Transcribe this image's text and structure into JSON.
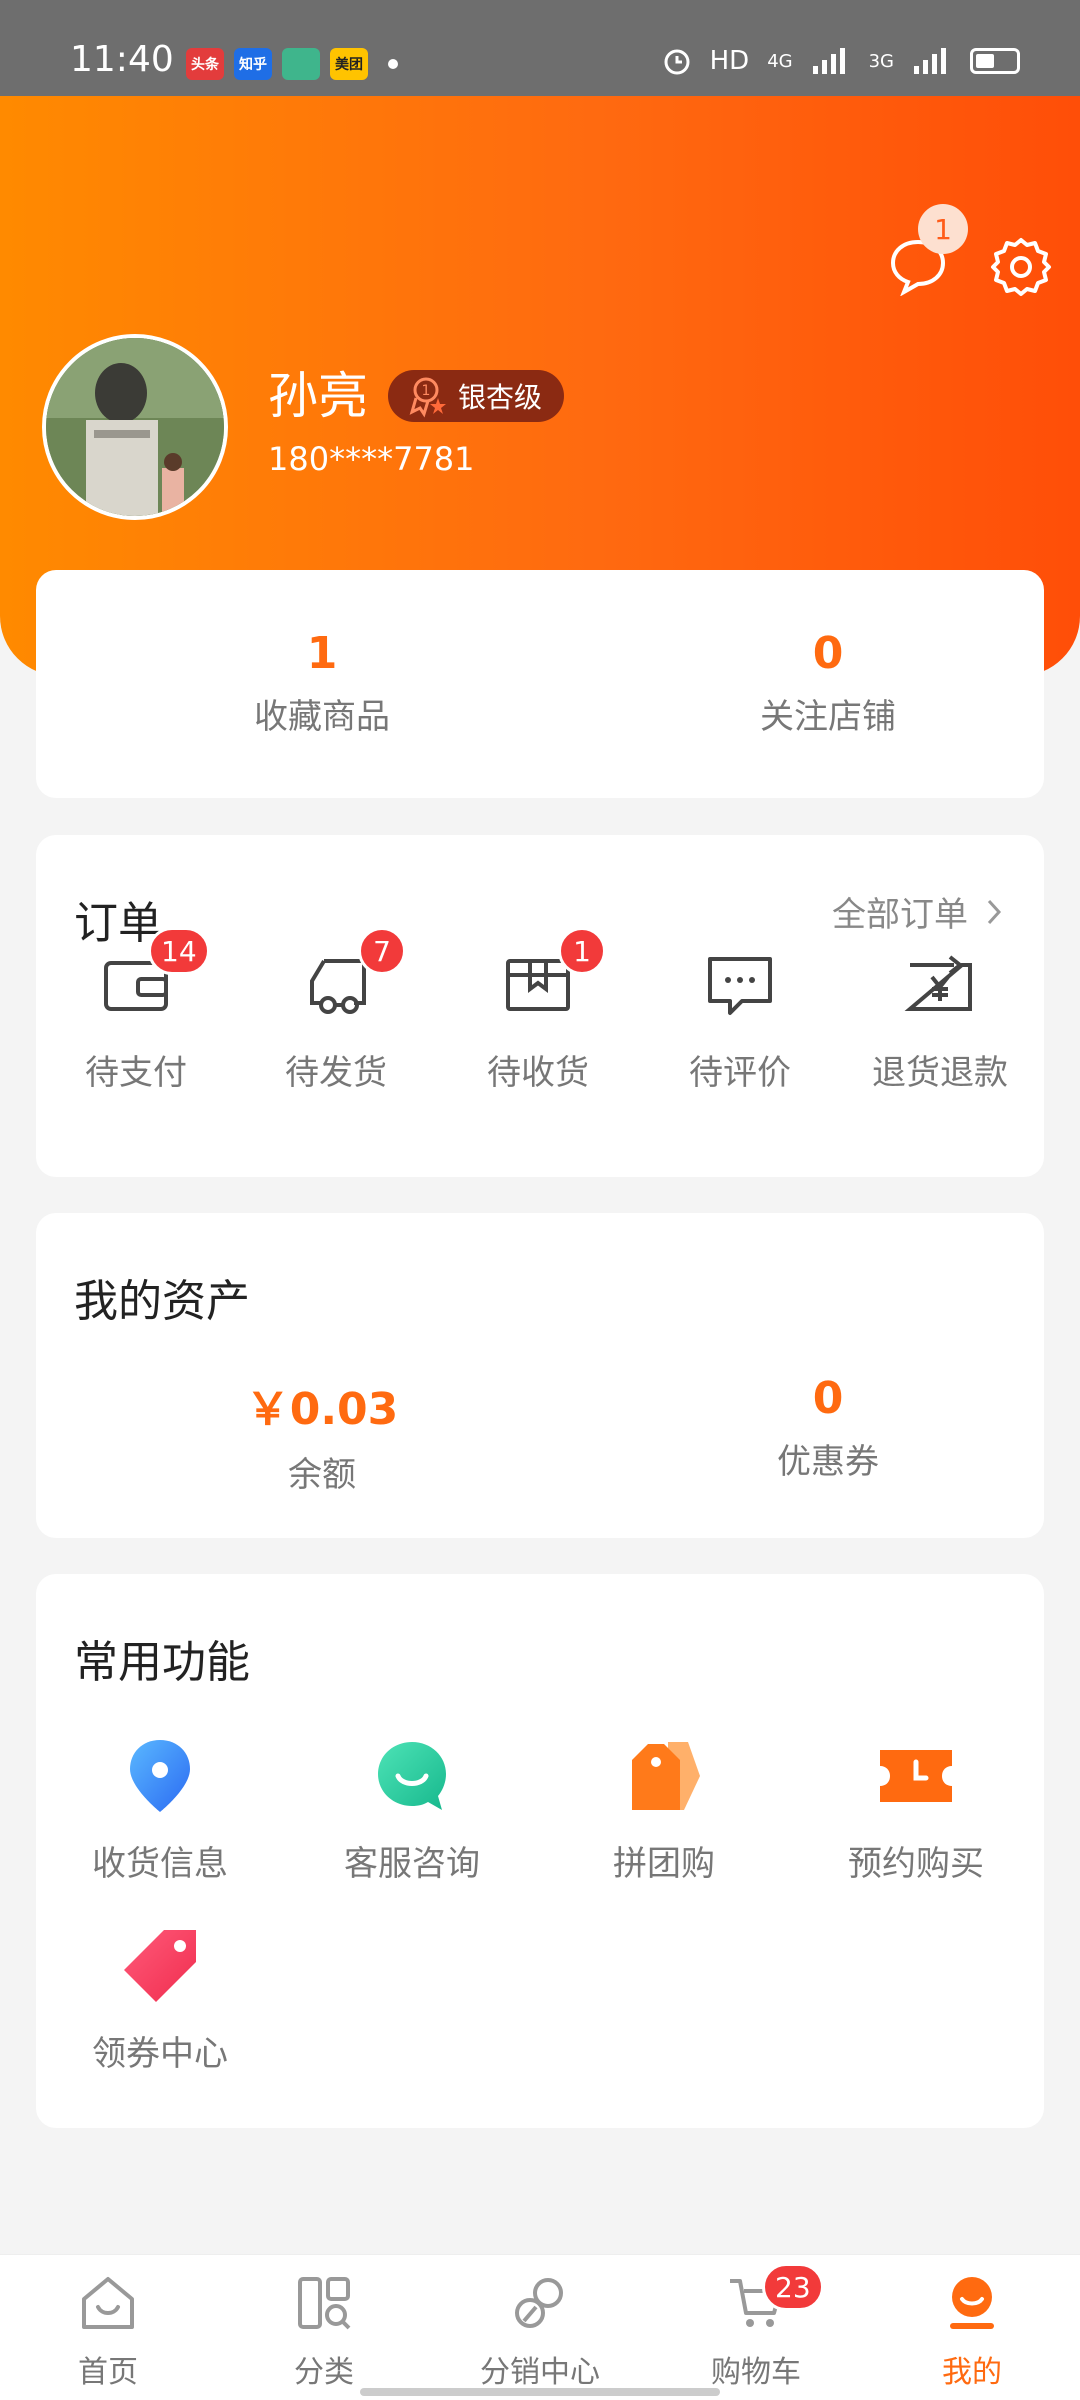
{
  "status_bar": {
    "time": "11:40",
    "apps": [
      {
        "name": "头条",
        "color": "#e33c3c"
      },
      {
        "name": "知乎",
        "color": "#1f6ee6"
      },
      {
        "name": "",
        "color": "#3fb58c"
      },
      {
        "name": "美团",
        "color": "#ffc300"
      }
    ],
    "network": "HD",
    "signal1": "4G",
    "signal2": "3G"
  },
  "header": {
    "message_badge": "1",
    "username": "孙亮",
    "level": "银杏级",
    "phone": "180****7781"
  },
  "stats": [
    {
      "value": "1",
      "label": "收藏商品"
    },
    {
      "value": "0",
      "label": "关注店铺"
    }
  ],
  "orders": {
    "title": "订单",
    "all_label": "全部订单",
    "items": [
      {
        "label": "待支付",
        "badge": "14",
        "icon": "wallet-icon"
      },
      {
        "label": "待发货",
        "badge": "7",
        "icon": "truck-icon"
      },
      {
        "label": "待收货",
        "badge": "1",
        "icon": "box-icon"
      },
      {
        "label": "待评价",
        "badge": "",
        "icon": "comment-icon"
      },
      {
        "label": "退货退款",
        "badge": "",
        "icon": "refund-icon"
      }
    ]
  },
  "assets": {
    "title": "我的资产",
    "items": [
      {
        "value": "￥0.03",
        "label": "余额"
      },
      {
        "value": "0",
        "label": "优惠券"
      }
    ]
  },
  "functions": {
    "title": "常用功能",
    "items": [
      {
        "label": "收货信息",
        "icon": "location-pin-icon"
      },
      {
        "label": "客服咨询",
        "icon": "customer-service-icon"
      },
      {
        "label": "拼团购",
        "icon": "group-buy-tag-icon"
      },
      {
        "label": "预约购买",
        "icon": "reservation-ticket-icon"
      },
      {
        "label": "领券中心",
        "icon": "coupon-tag-icon"
      }
    ]
  },
  "tabbar": {
    "items": [
      {
        "label": "首页",
        "icon": "home-icon"
      },
      {
        "label": "分类",
        "icon": "category-icon"
      },
      {
        "label": "分销中心",
        "icon": "distribution-icon"
      },
      {
        "label": "购物车",
        "icon": "cart-icon",
        "badge": "23"
      },
      {
        "label": "我的",
        "icon": "profile-icon"
      }
    ],
    "active": "我的"
  },
  "colors": {
    "accent": "#ff6a10",
    "badge": "#f23a3a"
  }
}
